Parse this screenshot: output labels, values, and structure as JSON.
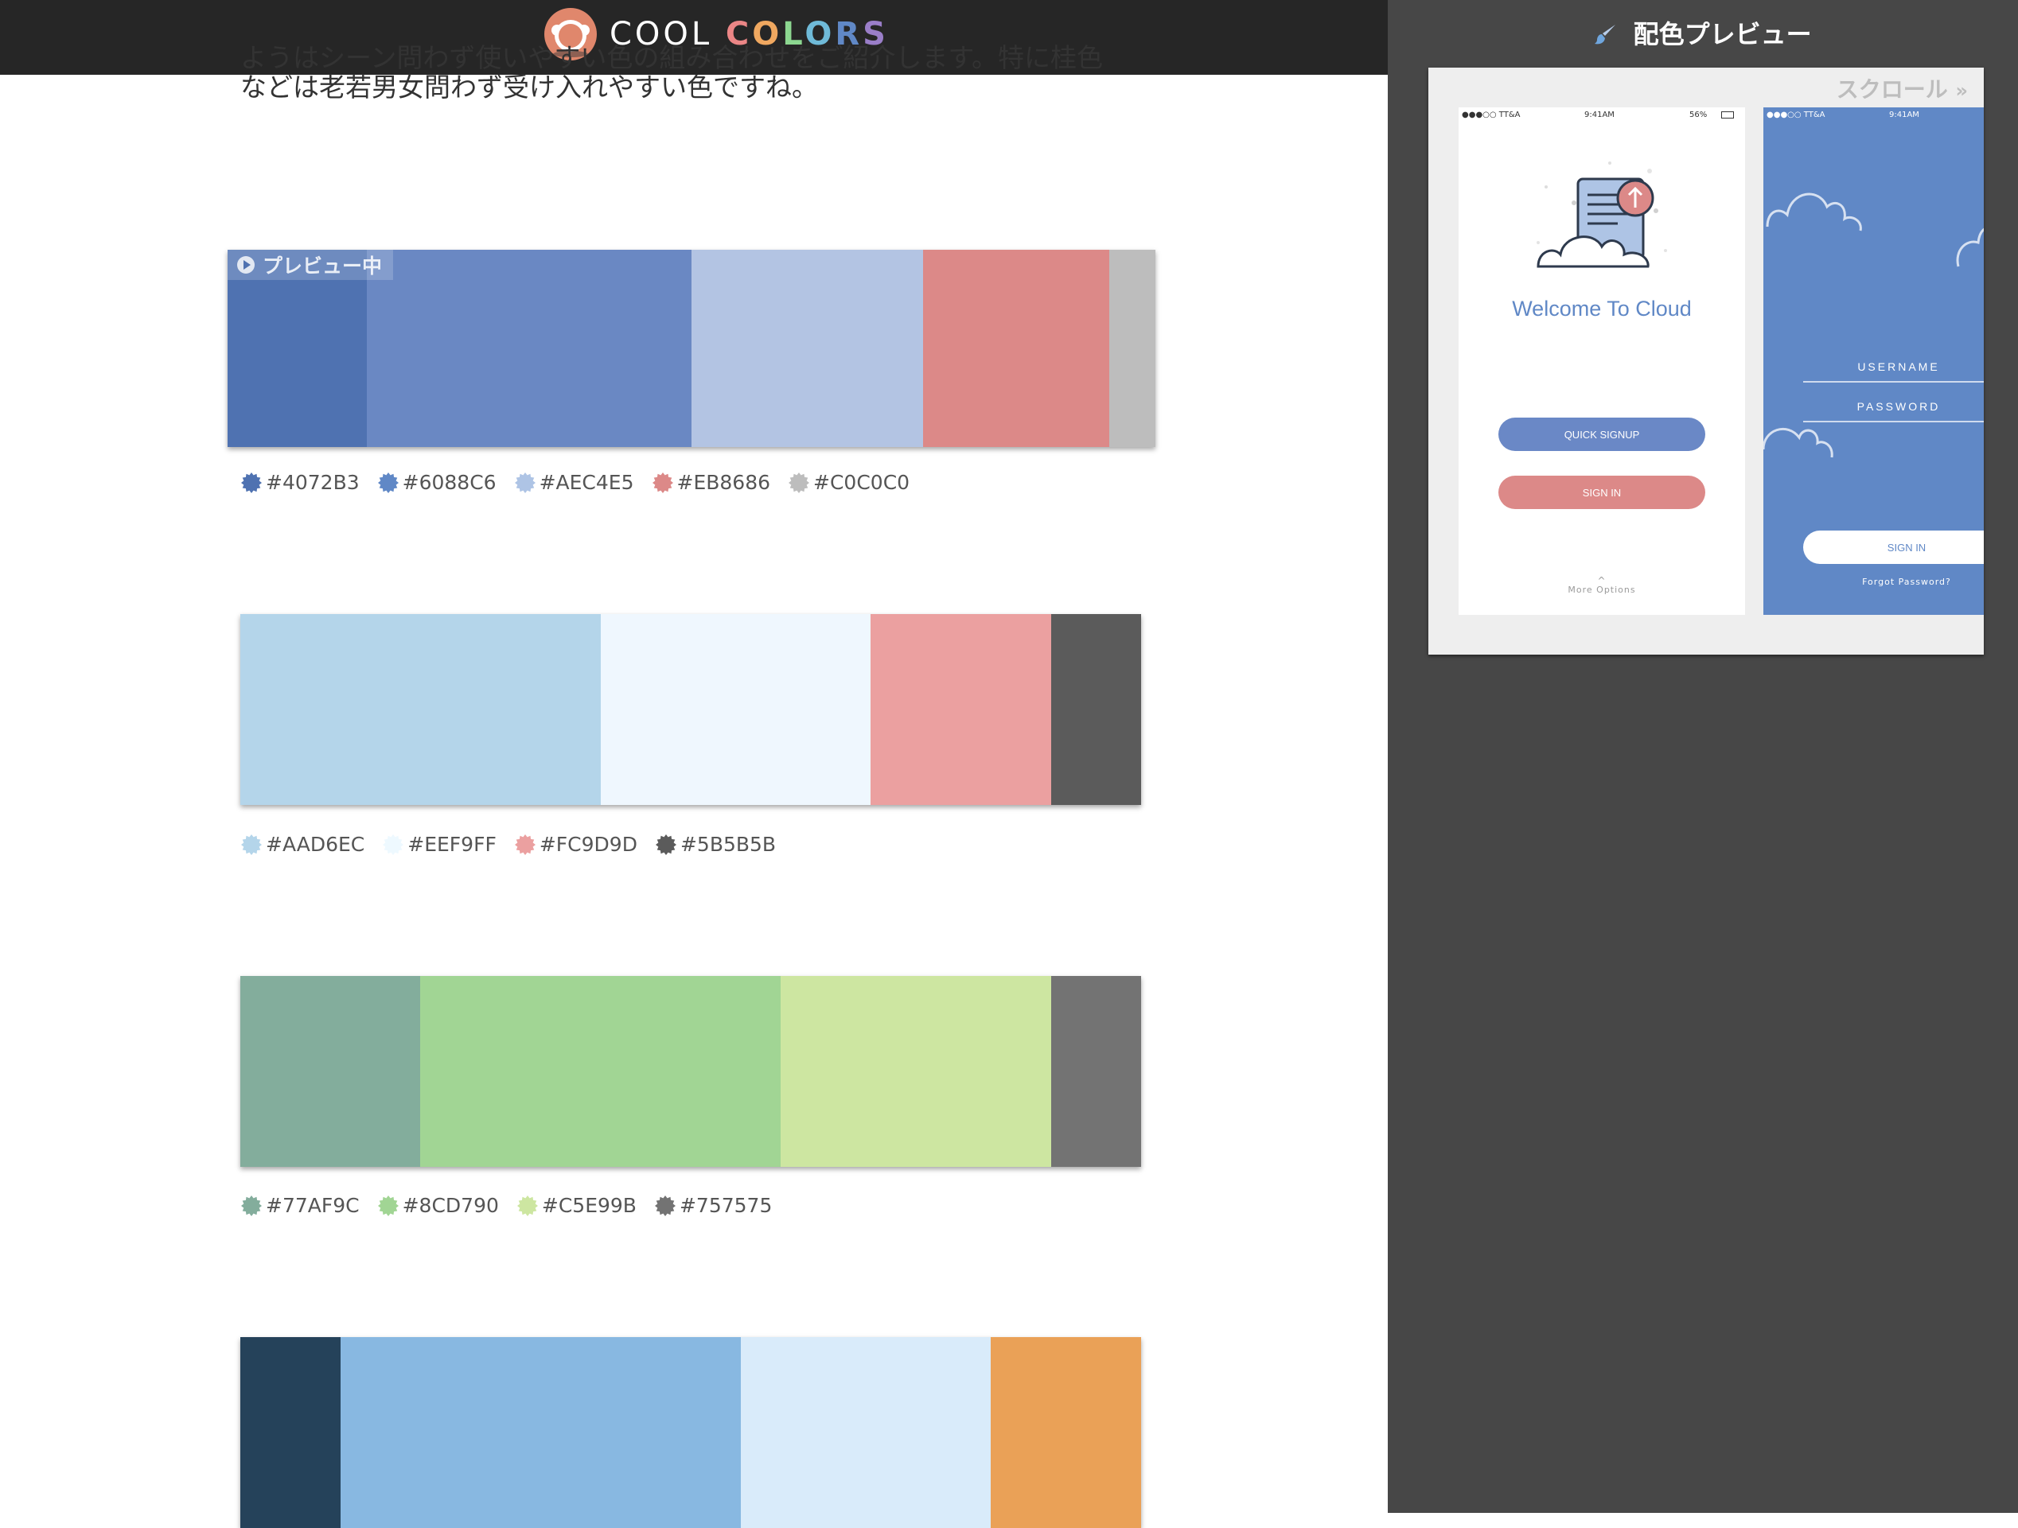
{
  "header": {
    "logo_word1": "COOL",
    "logo_word2_letters": [
      "C",
      "O",
      "L",
      "O",
      "R",
      "S"
    ],
    "logo_letter_colors": [
      "#eb8686",
      "#f0a860",
      "#8cd790",
      "#6fbad8",
      "#6088c6",
      "#9a7ec8"
    ]
  },
  "intro": {
    "line1": "ようはシーン問わず使いやすい色の組み合わせをご紹介します。特に桂色",
    "line2": "などは老若男女問わず受け入れやすい色ですね。"
  },
  "preview_tag": "プレビュー中",
  "palettes": [
    {
      "swatches": [
        {
          "color": "#4F72B1",
          "weight": 108
        },
        {
          "color": "#6A88C3",
          "weight": 252
        },
        {
          "color": "#B3C4E3",
          "weight": 180
        },
        {
          "color": "#DC8988",
          "weight": 144
        },
        {
          "color": "#BDBDBD",
          "weight": 36
        }
      ],
      "codes": [
        "#4072B3",
        "#6088C6",
        "#AEC4E5",
        "#EB8686",
        "#C0C0C0"
      ],
      "code_colors": [
        "#4F72B1",
        "#6088C6",
        "#AEC4E5",
        "#DC8988",
        "#BDBDBD"
      ]
    },
    {
      "swatches": [
        {
          "color": "#B4D5EA",
          "weight": 280
        },
        {
          "color": "#EFF7FE",
          "weight": 210
        },
        {
          "color": "#EBA0A0",
          "weight": 140
        },
        {
          "color": "#5B5B5B",
          "weight": 70
        }
      ],
      "codes": [
        "#AAD6EC",
        "#EEF9FF",
        "#FC9D9D",
        "#5B5B5B"
      ],
      "code_colors": [
        "#B4D5EA",
        "#EEF9FF",
        "#EBA0A0",
        "#5B5B5B"
      ]
    },
    {
      "swatches": [
        {
          "color": "#83AD9C",
          "weight": 140
        },
        {
          "color": "#A1D594",
          "weight": 280
        },
        {
          "color": "#CDE6A1",
          "weight": 210
        },
        {
          "color": "#737373",
          "weight": 70
        }
      ],
      "codes": [
        "#77AF9C",
        "#8CD790",
        "#C5E99B",
        "#757575"
      ],
      "code_colors": [
        "#83AD9C",
        "#A1D594",
        "#CDE6A1",
        "#737373"
      ]
    },
    {
      "swatches": [
        {
          "color": "#25425A",
          "weight": 78
        },
        {
          "color": "#88B8E1",
          "weight": 311
        },
        {
          "color": "#D9EBFA",
          "weight": 194
        },
        {
          "color": "#EAA157",
          "weight": 117
        }
      ],
      "codes": [],
      "code_colors": []
    }
  ],
  "side": {
    "title": "配色プレビュー",
    "scroll_label": "スクロール",
    "phone1": {
      "carrier": "●●●○○ TT&A",
      "time": "9:41AM",
      "battery": "56%",
      "welcome": "Welcome To Cloud",
      "quick_signup": "QUICK SIGNUP",
      "sign_in": "SIGN IN",
      "more_options": "More Options",
      "caret": "^"
    },
    "phone2": {
      "carrier": "●●●○○ TT&A",
      "time": "9:41AM",
      "username": "USERNAME",
      "password": "PASSWORD",
      "sign_in": "SIGN IN",
      "forgot": "Forgot Password?"
    },
    "colors": {
      "primary": "#6088C6",
      "light": "#AEC4E5",
      "accent": "#DC8988"
    }
  }
}
